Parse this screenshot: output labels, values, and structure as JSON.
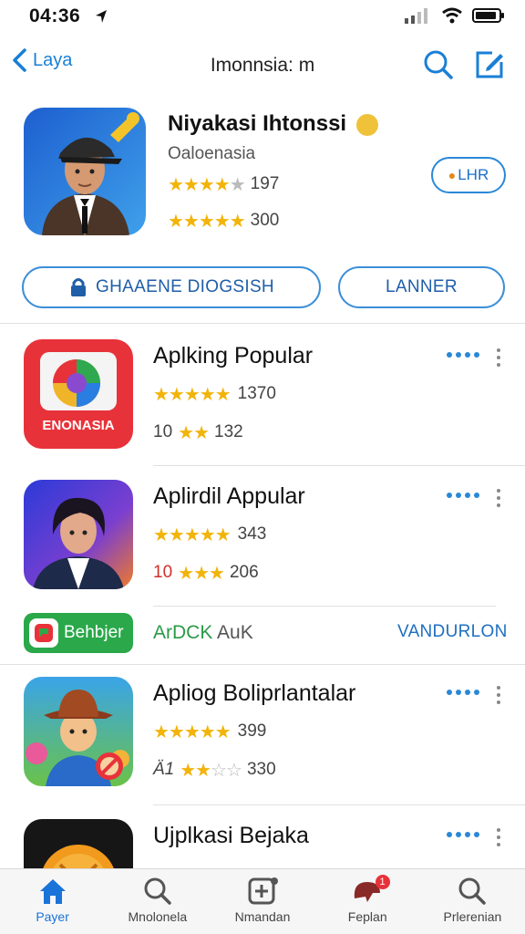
{
  "status_bar": {
    "time": "04:36",
    "icons": [
      "location-arrow-icon",
      "signal-icon",
      "wifi-icon",
      "battery-icon"
    ]
  },
  "nav": {
    "back_label": "Laya",
    "title": "Imonnsia: m"
  },
  "featured": {
    "title": "Niyakasi Ihtonssi",
    "subtitle": "Oaloenasia",
    "rating1_count": "197",
    "rating1_stars": 4,
    "rating2_count": "300",
    "rating2_stars": 5,
    "button_label": "LHR"
  },
  "actions": {
    "left_label": "GHAAENE DIOGSISH",
    "right_label": "LANNER"
  },
  "apps": [
    {
      "name": "Aplking Popular",
      "icon_text": "ENONASIA",
      "stars": 5,
      "count1": "1370",
      "line2_prefix": "10",
      "line2_stars": 2,
      "count2": "132"
    },
    {
      "name": "Aplirdil Appular",
      "stars": 5,
      "count1": "343",
      "line2_prefix": "10",
      "line2_stars": 3,
      "count2": "206"
    },
    {
      "name": "Aplіog Boliprlantalar",
      "stars": 5,
      "count1": "399",
      "line2_prefix": "Ä1",
      "line2_stars": 2,
      "count2": "330"
    },
    {
      "name": "Ujplkasi Bejaka"
    }
  ],
  "banner": {
    "badge_label": "Behbjer",
    "text_green": "ArDCK",
    "text_grey": "AuK",
    "link_label": "VANDURLON"
  },
  "tabs": [
    {
      "label": "Payer",
      "icon": "home-icon",
      "active": true
    },
    {
      "label": "Mnolonela",
      "icon": "search-icon"
    },
    {
      "label": "Nmandan",
      "icon": "add-square-icon"
    },
    {
      "label": "Feplan",
      "icon": "speech-bubble-icon",
      "badge": "1"
    },
    {
      "label": "Prlerenian",
      "icon": "search-icon"
    }
  ],
  "colors": {
    "accent": "#1a7fd6",
    "star": "#f2b40a",
    "green": "#2aa84a"
  }
}
